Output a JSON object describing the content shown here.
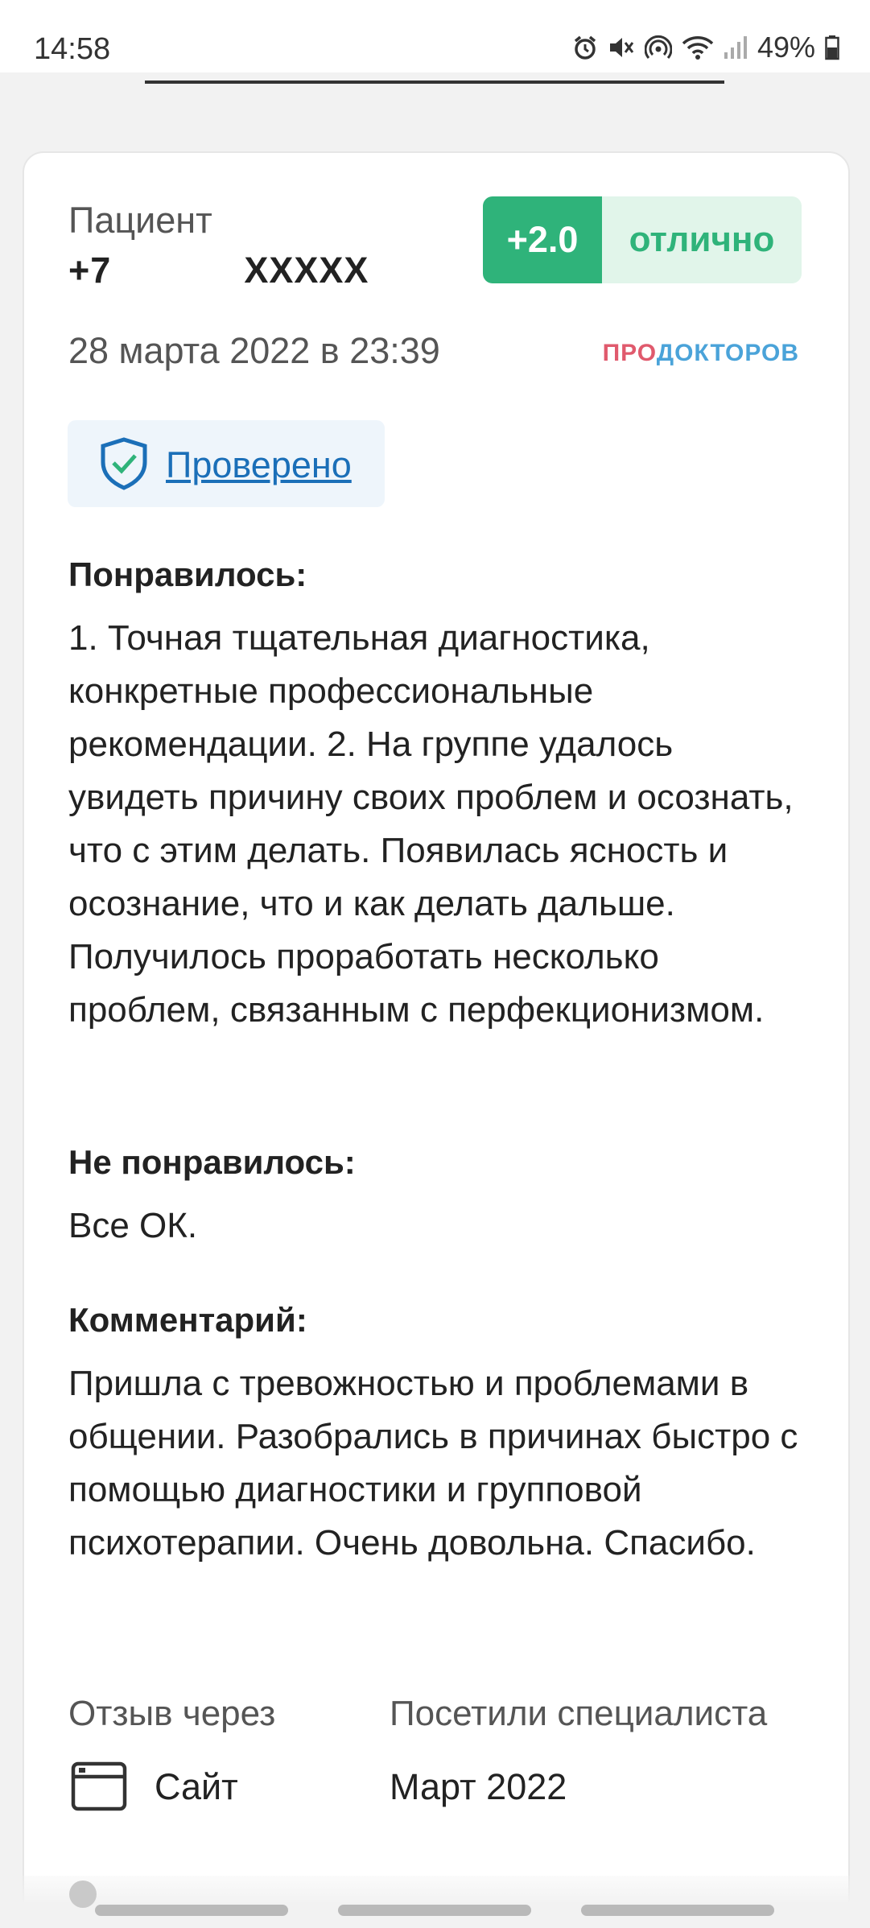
{
  "status_bar": {
    "time": "14:58",
    "battery": "49%",
    "icons": [
      "alarm-icon",
      "mute-icon",
      "hotspot-icon",
      "wifi-icon",
      "signal-icon",
      "battery-icon"
    ]
  },
  "review": {
    "patient_label": "Пациент",
    "patient_phone_prefix": "+7",
    "patient_phone_suffix": "XXXXX",
    "rating_score": "+2.0",
    "rating_text": "отлично",
    "date": "28 марта 2022 в 23:39",
    "brand_part1": "ПРО",
    "brand_part2": "ДОКТОРОВ",
    "verified_label": "Проверено",
    "liked_title": "Понравилось:",
    "liked_text": "1. Точная тщательная диагностика, конкретные профессиональные рекомендации. 2. На группе удалось увидеть причину своих проблем и осознать, что с этим делать. Появилась ясность и осознание, что и как делать дальше. Получилось проработать несколько проблем, связанным с перфекционизмом.",
    "disliked_title": "Не понравилось:",
    "disliked_text": "Все ОК.",
    "comment_title": "Комментарий:",
    "comment_text": "Пришла с тревожностью и проблемами в общении. Разобрались в причинах быстро с помощью диагностики и групповой психотерапии. Очень довольна. Спасибо.",
    "source_label": "Отзыв через",
    "source_value": "Сайт",
    "visited_label": "Посетили специалиста",
    "visited_value": "Март 2022"
  },
  "colors": {
    "rating_green": "#2fb37a",
    "rating_bg": "#e1f5ea",
    "link_blue": "#1b6fb8",
    "brand_red": "#e05a6d",
    "brand_blue": "#4aa3d9"
  }
}
